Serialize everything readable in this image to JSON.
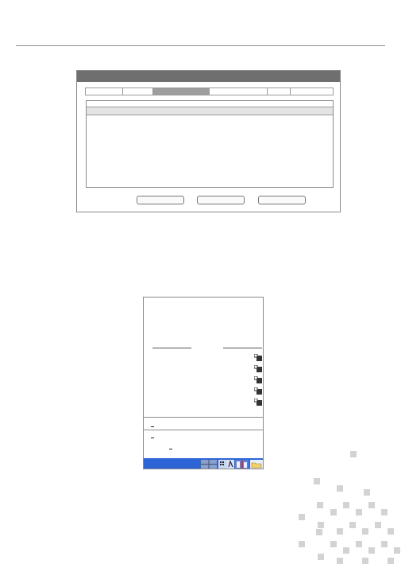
{
  "document": {
    "dialog": {
      "tab_count": 6,
      "active_tab": 2
    },
    "start_menu": {
      "program_entries": 5
    }
  },
  "colors": {
    "title_bar": "#6f6f6f",
    "active_tab": "#9e9e9e",
    "selected_row": "#e4e4e4",
    "taskbar": "#2d65d7",
    "decor_squares": "#d3d3d3"
  }
}
